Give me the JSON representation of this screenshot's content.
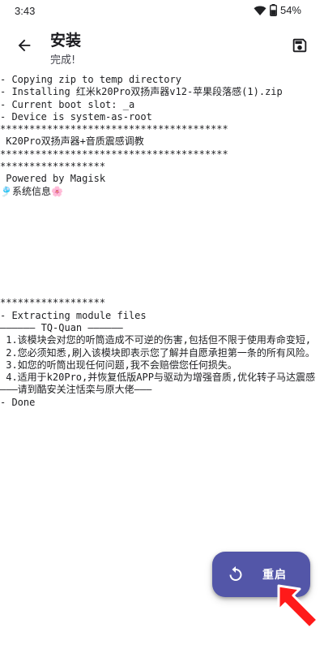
{
  "status_bar": {
    "time": "3:43",
    "battery": "54%",
    "icons": [
      "wifi-icon",
      "battery-icon"
    ]
  },
  "app_bar": {
    "back_icon": "arrow-back-icon",
    "title": "安装",
    "subtitle": "完成!",
    "save_icon": "save-icon"
  },
  "console": {
    "lines": [
      "- Copying zip to temp directory",
      "- Installing 红米k20Pro双扬声器v12-苹果段落感(1).zip",
      "- Current boot slot: _a",
      "- Device is system-as-root",
      "***************************************",
      " K20Pro双扬声器+音质震感调教",
      "***************************************",
      "******************",
      " Powered by Magisk",
      "🎐系统信息🌸",
      "",
      "",
      "",
      "",
      "",
      "",
      "",
      "",
      "******************",
      "- Extracting module files",
      "—————— TQ-Quan ——————",
      " 1.该模块会对您的听筒造成不可逆的伤害,包括但不限于使用寿命变短,",
      " 2.您必须知悉,刷入该模块即表示您了解并自愿承担第一条的所有风险。",
      " 3.如您的听筒出现任何问题,我不会赔偿您任何损失。",
      " 4.适用于k20Pro,并恢复低版APP与驱动为增强音质,优化转子马达震感",
      "———请到酷安关注恬栾与原大佬———",
      "- Done"
    ]
  },
  "fab": {
    "icon": "restart-icon",
    "label": "重启",
    "color": "#5356a8"
  },
  "annotation": {
    "icon": "red-pointer-arrow-icon",
    "color": "#ff0000"
  }
}
